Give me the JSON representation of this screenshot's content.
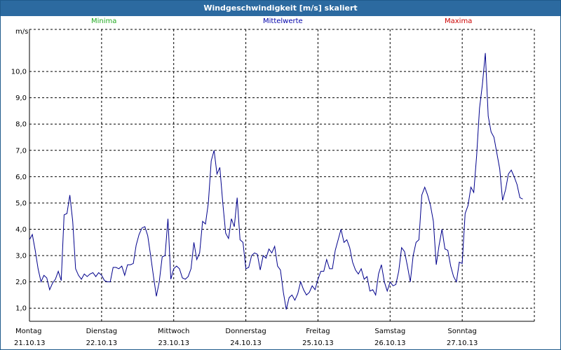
{
  "window": {
    "title": "Windgeschwindigkeit [m/s] skaliert"
  },
  "colors": {
    "minima": "#22aa22",
    "mittelwerte": "#0000aa",
    "maxima": "#cc0000",
    "line": "#00008b",
    "titlebar": "#2c6aa0"
  },
  "chart_data": {
    "type": "line",
    "title": "Windgeschwindigkeit [m/s] skaliert",
    "ylabel": "m/s",
    "ylim": [
      0.5,
      11.6
    ],
    "yticks": [
      1.0,
      2.0,
      3.0,
      4.0,
      5.0,
      6.0,
      7.0,
      8.0,
      9.0,
      10.0
    ],
    "ytick_labels": [
      "1,0",
      "2,0",
      "3,0",
      "4,0",
      "5,0",
      "6,0",
      "7,0",
      "8,0",
      "9,0",
      "10,0"
    ],
    "grid": true,
    "legend_items": [
      {
        "label": "Minima",
        "color": "#22aa22"
      },
      {
        "label": "Mittelwerte",
        "color": "#0000aa"
      },
      {
        "label": "Maxima",
        "color": "#cc0000"
      }
    ],
    "days": [
      {
        "weekday": "Montag",
        "date": "21.10.13"
      },
      {
        "weekday": "Dienstag",
        "date": "22.10.13"
      },
      {
        "weekday": "Mittwoch",
        "date": "23.10.13"
      },
      {
        "weekday": "Donnerstag",
        "date": "24.10.13"
      },
      {
        "weekday": "Freitag",
        "date": "25.10.13"
      },
      {
        "weekday": "Samstag",
        "date": "26.10.13"
      },
      {
        "weekday": "Sonntag",
        "date": "27.10.13"
      }
    ],
    "x_range_days": [
      0,
      7
    ],
    "series": [
      {
        "name": "Mittelwerte",
        "points": [
          [
            0.0,
            3.6
          ],
          [
            0.04,
            3.8
          ],
          [
            0.08,
            3.2
          ],
          [
            0.12,
            2.5
          ],
          [
            0.16,
            2.0
          ],
          [
            0.2,
            2.25
          ],
          [
            0.24,
            2.15
          ],
          [
            0.28,
            1.7
          ],
          [
            0.32,
            1.95
          ],
          [
            0.36,
            2.1
          ],
          [
            0.4,
            2.4
          ],
          [
            0.44,
            2.05
          ],
          [
            0.48,
            4.55
          ],
          [
            0.52,
            4.6
          ],
          [
            0.56,
            5.3
          ],
          [
            0.6,
            4.3
          ],
          [
            0.64,
            2.5
          ],
          [
            0.68,
            2.25
          ],
          [
            0.72,
            2.1
          ],
          [
            0.76,
            2.3
          ],
          [
            0.8,
            2.2
          ],
          [
            0.84,
            2.3
          ],
          [
            0.88,
            2.35
          ],
          [
            0.92,
            2.2
          ],
          [
            0.96,
            2.35
          ],
          [
            1.0,
            2.25
          ],
          [
            1.04,
            2.05
          ],
          [
            1.08,
            2.0
          ],
          [
            1.12,
            2.0
          ],
          [
            1.16,
            2.55
          ],
          [
            1.2,
            2.55
          ],
          [
            1.24,
            2.5
          ],
          [
            1.28,
            2.6
          ],
          [
            1.32,
            2.25
          ],
          [
            1.36,
            2.65
          ],
          [
            1.4,
            2.65
          ],
          [
            1.44,
            2.7
          ],
          [
            1.48,
            3.4
          ],
          [
            1.52,
            3.8
          ],
          [
            1.56,
            4.05
          ],
          [
            1.6,
            4.1
          ],
          [
            1.64,
            3.75
          ],
          [
            1.68,
            3.0
          ],
          [
            1.72,
            2.2
          ],
          [
            1.76,
            1.45
          ],
          [
            1.8,
            2.0
          ],
          [
            1.84,
            2.95
          ],
          [
            1.88,
            3.0
          ],
          [
            1.92,
            4.4
          ],
          [
            1.96,
            2.1
          ],
          [
            2.0,
            2.5
          ],
          [
            2.04,
            2.6
          ],
          [
            2.08,
            2.5
          ],
          [
            2.12,
            2.15
          ],
          [
            2.16,
            2.1
          ],
          [
            2.2,
            2.2
          ],
          [
            2.24,
            2.5
          ],
          [
            2.28,
            3.5
          ],
          [
            2.32,
            2.85
          ],
          [
            2.36,
            3.1
          ],
          [
            2.4,
            4.3
          ],
          [
            2.44,
            4.2
          ],
          [
            2.48,
            5.0
          ],
          [
            2.52,
            6.6
          ],
          [
            2.56,
            7.0
          ],
          [
            2.6,
            6.1
          ],
          [
            2.64,
            6.35
          ],
          [
            2.68,
            5.0
          ],
          [
            2.72,
            3.85
          ],
          [
            2.76,
            3.65
          ],
          [
            2.8,
            4.4
          ],
          [
            2.84,
            4.1
          ],
          [
            2.88,
            5.2
          ],
          [
            2.92,
            3.6
          ],
          [
            2.96,
            3.5
          ],
          [
            3.0,
            2.5
          ],
          [
            3.04,
            2.55
          ],
          [
            3.08,
            3.0
          ],
          [
            3.12,
            3.1
          ],
          [
            3.16,
            3.05
          ],
          [
            3.2,
            2.45
          ],
          [
            3.24,
            3.0
          ],
          [
            3.28,
            2.9
          ],
          [
            3.32,
            3.25
          ],
          [
            3.36,
            3.1
          ],
          [
            3.4,
            3.35
          ],
          [
            3.44,
            2.6
          ],
          [
            3.48,
            2.45
          ],
          [
            3.52,
            1.6
          ],
          [
            3.56,
            0.95
          ],
          [
            3.6,
            1.4
          ],
          [
            3.64,
            1.5
          ],
          [
            3.68,
            1.3
          ],
          [
            3.72,
            1.55
          ],
          [
            3.76,
            2.0
          ],
          [
            3.8,
            1.7
          ],
          [
            3.84,
            1.5
          ],
          [
            3.88,
            1.6
          ],
          [
            3.92,
            1.85
          ],
          [
            3.96,
            1.7
          ],
          [
            4.0,
            2.1
          ],
          [
            4.04,
            2.4
          ],
          [
            4.08,
            2.4
          ],
          [
            4.12,
            2.85
          ],
          [
            4.16,
            2.5
          ],
          [
            4.2,
            2.5
          ],
          [
            4.24,
            3.2
          ],
          [
            4.28,
            3.6
          ],
          [
            4.32,
            4.0
          ],
          [
            4.36,
            3.5
          ],
          [
            4.4,
            3.6
          ],
          [
            4.44,
            3.3
          ],
          [
            4.48,
            2.75
          ],
          [
            4.52,
            2.45
          ],
          [
            4.56,
            2.3
          ],
          [
            4.6,
            2.5
          ],
          [
            4.64,
            2.1
          ],
          [
            4.68,
            2.2
          ],
          [
            4.72,
            1.65
          ],
          [
            4.76,
            1.7
          ],
          [
            4.8,
            1.5
          ],
          [
            4.84,
            2.3
          ],
          [
            4.88,
            2.65
          ],
          [
            4.92,
            2.0
          ],
          [
            4.96,
            1.65
          ],
          [
            5.0,
            2.0
          ],
          [
            5.04,
            1.85
          ],
          [
            5.08,
            1.9
          ],
          [
            5.12,
            2.4
          ],
          [
            5.16,
            3.3
          ],
          [
            5.2,
            3.15
          ],
          [
            5.24,
            2.6
          ],
          [
            5.28,
            2.0
          ],
          [
            5.32,
            3.0
          ],
          [
            5.36,
            3.5
          ],
          [
            5.4,
            3.6
          ],
          [
            5.44,
            5.3
          ],
          [
            5.48,
            5.6
          ],
          [
            5.52,
            5.3
          ],
          [
            5.56,
            4.9
          ],
          [
            5.6,
            4.3
          ],
          [
            5.64,
            2.65
          ],
          [
            5.68,
            3.4
          ],
          [
            5.72,
            4.0
          ],
          [
            5.76,
            3.25
          ],
          [
            5.8,
            3.2
          ],
          [
            5.84,
            2.6
          ],
          [
            5.88,
            2.2
          ],
          [
            5.92,
            2.0
          ],
          [
            5.96,
            2.75
          ],
          [
            6.0,
            2.7
          ],
          [
            6.04,
            4.6
          ],
          [
            6.08,
            4.9
          ],
          [
            6.12,
            5.6
          ],
          [
            6.16,
            5.4
          ],
          [
            6.2,
            6.8
          ],
          [
            6.24,
            8.6
          ],
          [
            6.28,
            9.5
          ],
          [
            6.32,
            10.7
          ],
          [
            6.36,
            8.3
          ],
          [
            6.4,
            7.7
          ],
          [
            6.44,
            7.5
          ],
          [
            6.48,
            6.9
          ],
          [
            6.52,
            6.3
          ],
          [
            6.56,
            5.1
          ],
          [
            6.6,
            5.5
          ],
          [
            6.64,
            6.1
          ],
          [
            6.68,
            6.25
          ],
          [
            6.72,
            6.0
          ],
          [
            6.76,
            5.7
          ],
          [
            6.8,
            5.2
          ],
          [
            6.84,
            5.15
          ]
        ]
      }
    ]
  }
}
